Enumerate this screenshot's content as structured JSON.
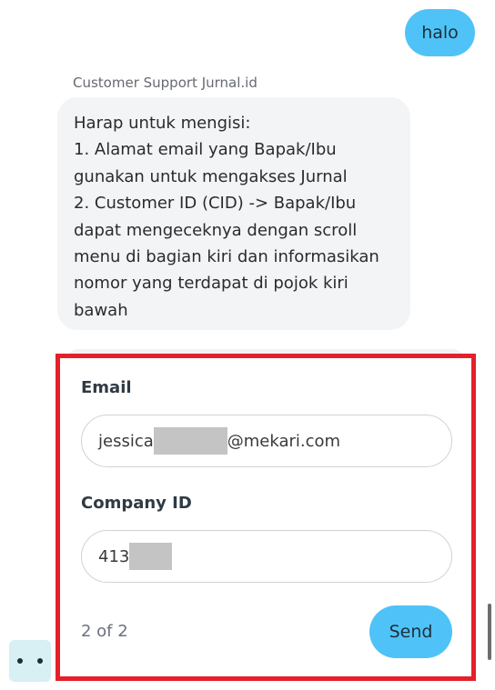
{
  "user_message": {
    "text": "halo"
  },
  "agent_message": {
    "sender": "Customer Support Jurnal.id",
    "lines": [
      "Harap untuk mengisi:",
      "1. Alamat email yang Bapak/Ibu",
      "gunakan untuk mengakses Jurnal",
      "2. Customer ID (CID) -> Bapak/Ibu",
      "dapat mengeceknya dengan scroll",
      "menu di bagian kiri dan informasikan",
      "nomor yang terdapat di pojok kiri",
      "bawah"
    ]
  },
  "form": {
    "email_label": "Email",
    "email_value_prefix": "jessica",
    "email_value_suffix": "@mekari.com",
    "company_label": "Company ID",
    "company_value_prefix": "413",
    "page_indicator": "2 of 2",
    "send_label": "Send"
  },
  "colors": {
    "accent": "#4fc3f7",
    "highlight_frame": "#e5202a",
    "bubble_bg": "#f3f4f6",
    "launcher_bg": "#d8eff4"
  },
  "icons": {
    "launcher": "chat-bot-face-icon"
  }
}
